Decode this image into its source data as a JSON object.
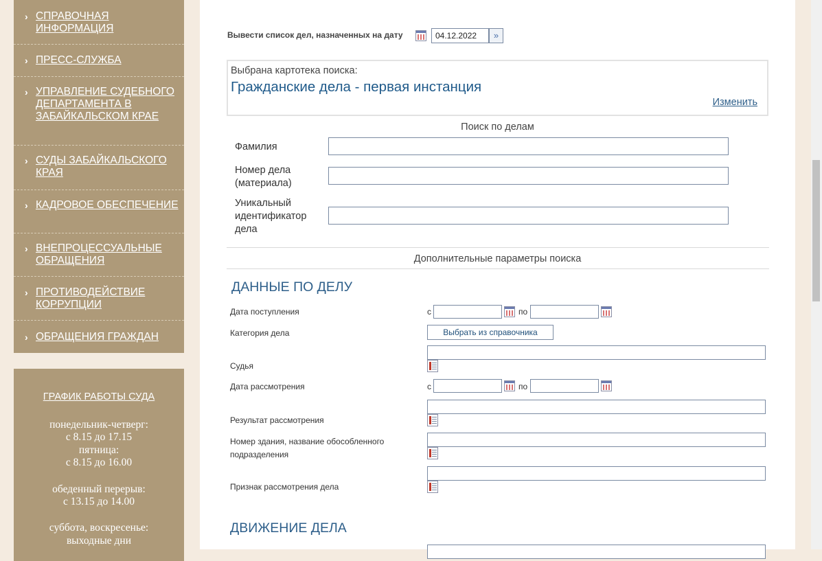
{
  "sidebar": {
    "items": [
      {
        "label": "СПРАВОЧНАЯ ИНФОРМАЦИЯ"
      },
      {
        "label": "ПРЕСС-СЛУЖБА"
      },
      {
        "label": "УПРАВЛЕНИЕ СУДЕБНОГО ДЕПАРТАМЕНТА В ЗАБАЙКАЛЬСКОМ КРАЕ"
      },
      {
        "label": "СУДЫ ЗАБАЙКАЛЬСКОГО КРАЯ"
      },
      {
        "label": "КАДРОВОЕ ОБЕСПЕЧЕНИЕ"
      },
      {
        "label": "ВНЕПРОЦЕССУАЛЬНЫЕ ОБРАЩЕНИЯ"
      },
      {
        "label": "ПРОТИВОДЕЙСТВИЕ КОРРУПЦИИ"
      },
      {
        "label": "ОБРАЩЕНИЯ ГРАЖДАН"
      }
    ],
    "chevron": "›",
    "schedule": {
      "title": "ГРАФИК РАБОТЫ СУДА",
      "lines": [
        "понедельник-четверг:",
        "с 8.15 до 17.15",
        "пятница:",
        "с 8.15 до 16.00",
        "обеденный перерыв:",
        "с 13.15 до 14.00",
        "суббота, воскресенье:",
        "выходные дни"
      ]
    }
  },
  "date_list": {
    "label": "Вывести список дел, назначенных на дату",
    "value": "04.12.2022"
  },
  "card_index": {
    "caption": "Выбрана картотека поиска:",
    "selected": "Гражданские дела - первая инстанция",
    "change_link": "Изменить"
  },
  "case_search": {
    "title": "Поиск по делам",
    "surname_label": "Фамилия",
    "case_number_label_1": "Номер дела",
    "case_number_label_2": "(материала)",
    "uid_label_1": "Уникальный",
    "uid_label_2": "идентификатор",
    "uid_label_3": "дела"
  },
  "extra_params_title": "Дополнительные параметры поиска",
  "case_data": {
    "title": "ДАННЫЕ ПО ДЕЛУ",
    "receipt_date_label": "Дата поступления",
    "from_label": "с",
    "to_label": "по",
    "category_label": "Категория дела",
    "category_button": "Выбрать из справочника",
    "judge_label": "Судья",
    "hearing_date_label": "Дата рассмотрения",
    "result_label": "Результат рассмотрения",
    "building_label_1": "Номер здания, название обособленного",
    "building_label_2": "подразделения",
    "sign_label": "Признак рассмотрения дела"
  },
  "movement": {
    "title": "ДВИЖЕНИЕ ДЕЛА"
  }
}
